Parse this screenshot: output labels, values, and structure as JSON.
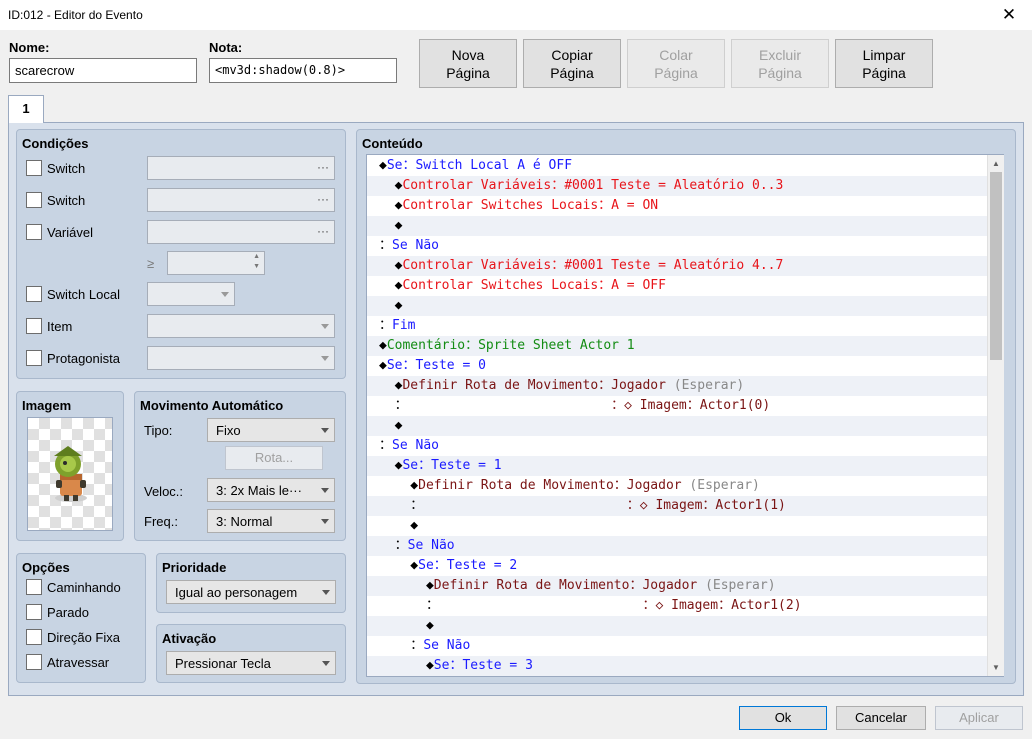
{
  "window": {
    "title": "ID:012 - Editor do Evento",
    "close_glyph": "✕"
  },
  "fields": {
    "name_label": "Nome:",
    "name_value": "scarecrow",
    "note_label": "Nota:",
    "note_value": "<mv3d:shadow(0.8)>"
  },
  "page_buttons": {
    "new_1": "Nova",
    "new_2": "Página",
    "copy_1": "Copiar",
    "copy_2": "Página",
    "paste_1": "Colar",
    "paste_2": "Página",
    "delete_1": "Excluir",
    "delete_2": "Página",
    "clear_1": "Limpar",
    "clear_2": "Página"
  },
  "tab": {
    "label": "1"
  },
  "conditions": {
    "title": "Condições",
    "switch1": "Switch",
    "switch2": "Switch",
    "variable": "Variável",
    "gte": "≥",
    "self_switch": "Switch Local",
    "item": "Item",
    "actor": "Protagonista",
    "dots": "···"
  },
  "image": {
    "title": "Imagem"
  },
  "auto_movement": {
    "title": "Movimento Automático",
    "type_label": "Tipo:",
    "type_value": "Fixo",
    "route_button": "Rota...",
    "speed_label": "Veloc.:",
    "speed_value": "3: 2x Mais le···",
    "freq_label": "Freq.:",
    "freq_value": "3: Normal"
  },
  "options": {
    "title": "Opções",
    "walking": "Caminhando",
    "stepping": "Parado",
    "dir_fix": "Direção Fixa",
    "through": "Atravessar"
  },
  "priority": {
    "title": "Prioridade",
    "value": "Igual ao personagem"
  },
  "trigger": {
    "title": "Ativação",
    "value": "Pressionar Tecla"
  },
  "contents": {
    "title": "Conteúdo",
    "rows": [
      {
        "pre": "◆",
        "parts": [
          {
            "t": "Se：Switch Local A é OFF",
            "c": "c-blue"
          }
        ]
      },
      {
        "pre": "  ◆",
        "parts": [
          {
            "t": "Controlar Variáveis：#0001 Teste = Aleatório 0..3",
            "c": "c-red"
          }
        ]
      },
      {
        "pre": "  ◆",
        "parts": [
          {
            "t": "Controlar Switches Locais：A = ON",
            "c": "c-red"
          }
        ]
      },
      {
        "pre": "  ◆",
        "parts": []
      },
      {
        "pre": "：",
        "parts": [
          {
            "t": "Se Não",
            "c": "c-blue"
          }
        ]
      },
      {
        "pre": "  ◆",
        "parts": [
          {
            "t": "Controlar Variáveis：#0001 Teste = Aleatório 4..7",
            "c": "c-red"
          }
        ]
      },
      {
        "pre": "  ◆",
        "parts": [
          {
            "t": "Controlar Switches Locais：A = OFF",
            "c": "c-red"
          }
        ]
      },
      {
        "pre": "  ◆",
        "parts": []
      },
      {
        "pre": "：",
        "parts": [
          {
            "t": "Fim",
            "c": "c-blue"
          }
        ]
      },
      {
        "pre": "◆",
        "parts": [
          {
            "t": "Comentário：Sprite Sheet Actor 1",
            "c": "c-green"
          }
        ]
      },
      {
        "pre": "◆",
        "parts": [
          {
            "t": "Se：Teste = 0",
            "c": "c-blue"
          }
        ]
      },
      {
        "pre": "  ◆",
        "parts": [
          {
            "t": "Definir Rota de Movimento：Jogador ",
            "c": "c-dark"
          },
          {
            "t": "(Esperar)",
            "c": "c-gray"
          }
        ]
      },
      {
        "pre": "  ：",
        "parts": [
          {
            "t": "                          ：◇ Imagem：Actor1(0)",
            "c": "c-dark"
          }
        ]
      },
      {
        "pre": "  ◆",
        "parts": []
      },
      {
        "pre": "：",
        "parts": [
          {
            "t": "Se Não",
            "c": "c-blue"
          }
        ]
      },
      {
        "pre": "  ◆",
        "parts": [
          {
            "t": "Se：Teste = 1",
            "c": "c-blue"
          }
        ]
      },
      {
        "pre": "    ◆",
        "parts": [
          {
            "t": "Definir Rota de Movimento：Jogador ",
            "c": "c-dark"
          },
          {
            "t": "(Esperar)",
            "c": "c-gray"
          }
        ]
      },
      {
        "pre": "    ：",
        "parts": [
          {
            "t": "                          ：◇ Imagem：Actor1(1)",
            "c": "c-dark"
          }
        ]
      },
      {
        "pre": "    ◆",
        "parts": []
      },
      {
        "pre": "  ：",
        "parts": [
          {
            "t": "Se Não",
            "c": "c-blue"
          }
        ]
      },
      {
        "pre": "    ◆",
        "parts": [
          {
            "t": "Se：Teste = 2",
            "c": "c-blue"
          }
        ]
      },
      {
        "pre": "      ◆",
        "parts": [
          {
            "t": "Definir Rota de Movimento：Jogador ",
            "c": "c-dark"
          },
          {
            "t": "(Esperar)",
            "c": "c-gray"
          }
        ]
      },
      {
        "pre": "      ：",
        "parts": [
          {
            "t": "                          ：◇ Imagem：Actor1(2)",
            "c": "c-dark"
          }
        ]
      },
      {
        "pre": "      ◆",
        "parts": []
      },
      {
        "pre": "    ：",
        "parts": [
          {
            "t": "Se Não",
            "c": "c-blue"
          }
        ]
      },
      {
        "pre": "      ◆",
        "parts": [
          {
            "t": "Se：Teste = 3",
            "c": "c-blue"
          }
        ]
      }
    ]
  },
  "footer": {
    "ok": "Ok",
    "cancel": "Cancelar",
    "apply": "Aplicar"
  }
}
